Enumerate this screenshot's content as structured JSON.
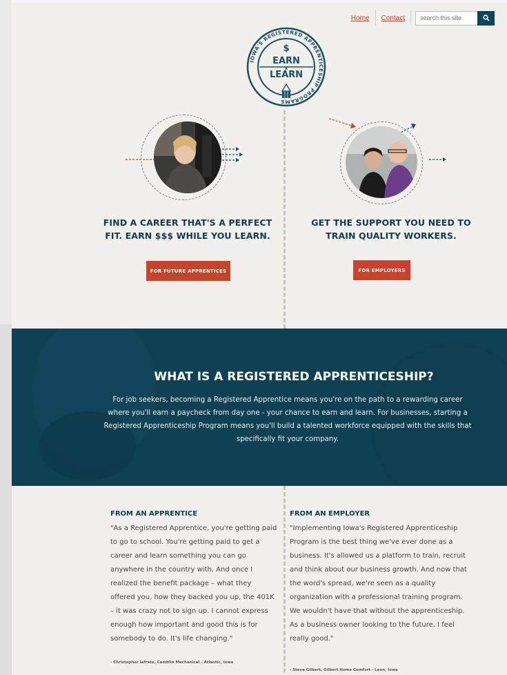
{
  "nav": {
    "home": "Home",
    "contact": "Contact",
    "search_placeholder": "search this site"
  },
  "logo": {
    "ring_text": "IOWA'S REGISTERED APPRENTICESHIP PROGRAMS",
    "line1": "EARN",
    "line2": "LEARN",
    "symbol": "$",
    "x": "x"
  },
  "left": {
    "headline_1": "FIND A CAREER THAT'S A PERFECT",
    "headline_2": "FIT. EARN $$$ WHILE YOU LEARN.",
    "cta": "FOR FUTURE APPRENTICES"
  },
  "right": {
    "headline_1": "GET THE SUPPORT YOU NEED TO",
    "headline_2": "TRAIN QUALITY WORKERS.",
    "cta": "FOR EMPLOYERS"
  },
  "banner": {
    "title": "WHAT IS A REGISTERED APPRENTICESHIP?",
    "body": "For job seekers, becoming a Registered Apprentice means you're on the path to a rewarding career where you'll earn a paycheck from day one - your chance to earn and learn. For businesses, starting a Registered Apprenticeship Program means you'll build a talented workforce equipped with the skills that specifically fit your company."
  },
  "testimonials": {
    "apprentice": {
      "heading": "FROM AN APPRENTICE",
      "quote": "\"As a Registered Apprentice, you're getting paid to go to school. You're getting paid to get a career and learn something you can go anywhere in the country with. And once I realized the benefit package – what they offered you, how they backed you up, the 401K – it was crazy not to sign up. I cannot express enough how important and good this is for somebody to do. It's life changing.\"",
      "cite": "- Christopher Iafrate, Camblin Mechanical - Atlantic, Iowa"
    },
    "employer": {
      "heading": "FROM AN EMPLOYER",
      "quote": "\"Implementing Iowa's Registered Apprenticeship Program is the best thing we've ever done as a business. It's allowed us a platform to train, recruit and think about our business growth. And now that the word's spread, we're seen as a quality organization with a professional training program. We wouldn't have that without the apprenticeship. As a business owner looking to the future, I feel really good.\"",
      "cite": "- Steve Gilbert, Gilbert Home Comfort - Leon, Iowa"
    }
  },
  "colors": {
    "brand_navy": "#0c3d52",
    "accent_red": "#c5442b",
    "banner": "#0f4154"
  },
  "icons": [
    "search-icon",
    "pencil-icon",
    "arrow-icon"
  ]
}
